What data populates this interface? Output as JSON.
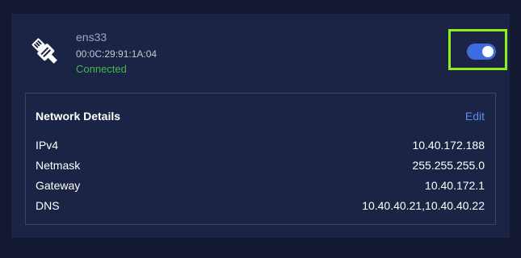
{
  "adapter": {
    "name": "ens33",
    "mac": "00:0C:29:91:1A:04",
    "status": "Connected",
    "icon": "ethernet-plug-icon",
    "enabled": true
  },
  "details": {
    "title": "Network Details",
    "edit_label": "Edit",
    "rows": [
      {
        "label": "IPv4",
        "value": "10.40.172.188"
      },
      {
        "label": "Netmask",
        "value": "255.255.255.0"
      },
      {
        "label": "Gateway",
        "value": "10.40.172.1"
      },
      {
        "label": "DNS",
        "value": "10.40.40.21,10.40.40.22"
      }
    ]
  },
  "colors": {
    "page_bg": "#111830",
    "card_bg": "#1b2444",
    "accent": "#3d6be0",
    "link": "#5b8dee",
    "status_ok": "#3fb950",
    "highlight": "#8cf01a"
  }
}
